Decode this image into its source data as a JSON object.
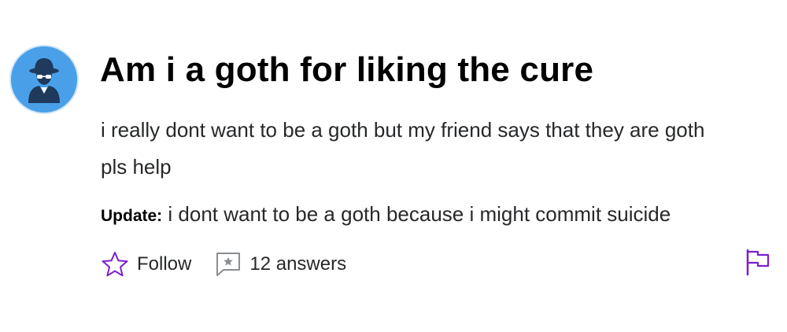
{
  "question": {
    "avatar_icon": "anonymous-spy-avatar-icon",
    "title": "Am i a goth for liking the cure",
    "body_line_1": "i really dont want to be a goth but my friend says that they are goth",
    "body_line_2": "pls help",
    "update_label": "Update:",
    "update_text": "i dont want to be a goth because i might commit suicide"
  },
  "actions": {
    "follow_icon": "star-outline-icon",
    "follow_label": "Follow",
    "answers_icon": "chat-bubble-star-icon",
    "answers_label": "12 answers",
    "flag_icon": "flag-icon"
  },
  "colors": {
    "accent_purple": "#7b1fd1",
    "avatar_blue": "#4aa0e8",
    "text_dark": "#26282a",
    "icon_gray": "#8a8d91"
  }
}
